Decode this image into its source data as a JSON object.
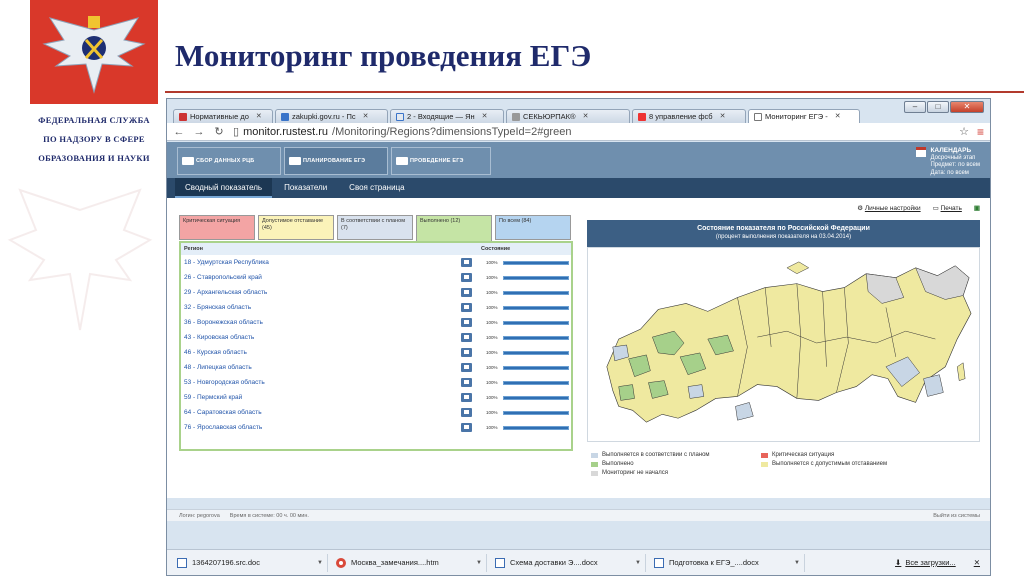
{
  "slide": {
    "title": "Мониторинг проведения ЕГЭ",
    "agency_lines": [
      "ФЕДЕРАЛЬНАЯ СЛУЖБА",
      "ПО НАДЗОРУ В СФЕРЕ",
      "ОБРАЗОВАНИЯ И НАУКИ"
    ]
  },
  "browser": {
    "tabs": [
      {
        "label": "Нормативные до",
        "active": false
      },
      {
        "label": "zakupki.gov.ru - Пс",
        "active": false
      },
      {
        "label": "2 - Входящие — Ян",
        "active": false
      },
      {
        "label": "СЕКЬЮРПАК®",
        "active": false
      },
      {
        "label": "8 управление фсб",
        "active": false
      },
      {
        "label": "Мониторинг ЕГЭ -",
        "active": true
      }
    ],
    "url_host": "monitor.rustest.ru",
    "url_path": "/Monitoring/Regions?dimensionsTypeId=2#green"
  },
  "app": {
    "top_buttons": [
      "СБОР ДАННЫХ РЦБ",
      "ПЛАНИРОВАНИЕ ЕГЭ",
      "ПРОВЕДЕНИЕ ЕГЭ"
    ],
    "calendar": {
      "title": "КАЛЕНДАРЬ",
      "line1": "Досрочный этап",
      "line2": "Предмет: по всем",
      "line3": "Дата: по всем"
    },
    "menu": [
      "Сводный показатель",
      "Показатели",
      "Своя страница"
    ],
    "toolbar": {
      "settings": "Личные настройки",
      "print": "Печать"
    }
  },
  "filters": {
    "critical": "Критическая ситуация",
    "allowed": "Допустимое отставание (45)",
    "planned": "В соответствии с планом (7)",
    "done": "Выполнено (12)",
    "all": "По всем (84)"
  },
  "table": {
    "col_region": "Регион",
    "col_state": "Состояние",
    "rows": [
      {
        "region": "18 - Удмуртская Республика",
        "pct": "100%",
        "progress": 100
      },
      {
        "region": "26 - Ставропольский край",
        "pct": "100%",
        "progress": 100
      },
      {
        "region": "29 - Архангельская область",
        "pct": "100%",
        "progress": 100
      },
      {
        "region": "32 - Брянская область",
        "pct": "100%",
        "progress": 100
      },
      {
        "region": "36 - Воронежская область",
        "pct": "100%",
        "progress": 100
      },
      {
        "region": "43 - Кировская область",
        "pct": "100%",
        "progress": 100
      },
      {
        "region": "46 - Курская область",
        "pct": "100%",
        "progress": 100
      },
      {
        "region": "48 - Липецкая область",
        "pct": "100%",
        "progress": 100
      },
      {
        "region": "53 - Новгородская область",
        "pct": "100%",
        "progress": 100
      },
      {
        "region": "59 - Пермский край",
        "pct": "100%",
        "progress": 100
      },
      {
        "region": "64 - Саратовская область",
        "pct": "100%",
        "progress": 100
      },
      {
        "region": "76 - Ярославская область",
        "pct": "100%",
        "progress": 100
      }
    ]
  },
  "map": {
    "title": "Состояние показателя по Российской Федерации",
    "subtitle": "(процент выполнения показателя на 03.04.2014)",
    "legend": [
      {
        "label": "Выполняется в соответствии с планом",
        "color": "#c8d6e5"
      },
      {
        "label": "Критическая ситуация",
        "color": "#e8645a"
      },
      {
        "label": "Выполнено",
        "color": "#a6d08a"
      },
      {
        "label": "Выполняется с допустимым отставанием",
        "color": "#efe9a0"
      },
      {
        "label": "Мониторинг не начался",
        "color": "#d8d8d8"
      }
    ]
  },
  "status": {
    "login": "Логин: pegorova",
    "time": "Время в системе: 00 ч. 00 мин.",
    "exit": "Выйти из системы"
  },
  "downloads": {
    "items": [
      "1364207196.src.doc",
      "Москва_замечания....htm",
      "Схема доставки Э....docx",
      "Подготовка к ЕГЭ_....docx"
    ],
    "all": "Все загрузки..."
  }
}
